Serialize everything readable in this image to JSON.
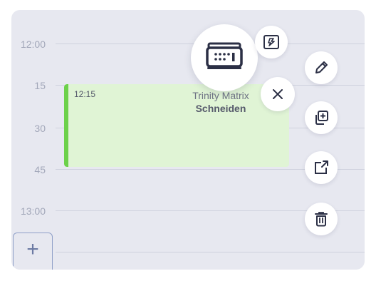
{
  "time_labels": [
    "12:00",
    "15",
    "30",
    "45",
    "13:00"
  ],
  "event": {
    "time": "12:15",
    "title": "Trinity Matrix",
    "subtitle": "Schneiden",
    "accent_color": "#6cd14a",
    "background_color": "#e0f4d5"
  },
  "add_tab": {
    "label": "+"
  },
  "actions": [
    {
      "name": "keyboard",
      "icon": "keyboard-icon"
    },
    {
      "name": "swap",
      "icon": "swap-icon"
    },
    {
      "name": "close",
      "icon": "close-icon"
    },
    {
      "name": "edit",
      "icon": "pencil-icon"
    },
    {
      "name": "duplicate",
      "icon": "duplicate-icon"
    },
    {
      "name": "open-external",
      "icon": "open-external-icon"
    },
    {
      "name": "delete",
      "icon": "trash-icon"
    }
  ],
  "colors": {
    "panel_background": "#e7e8f0",
    "icon_color": "#2b2f45"
  }
}
